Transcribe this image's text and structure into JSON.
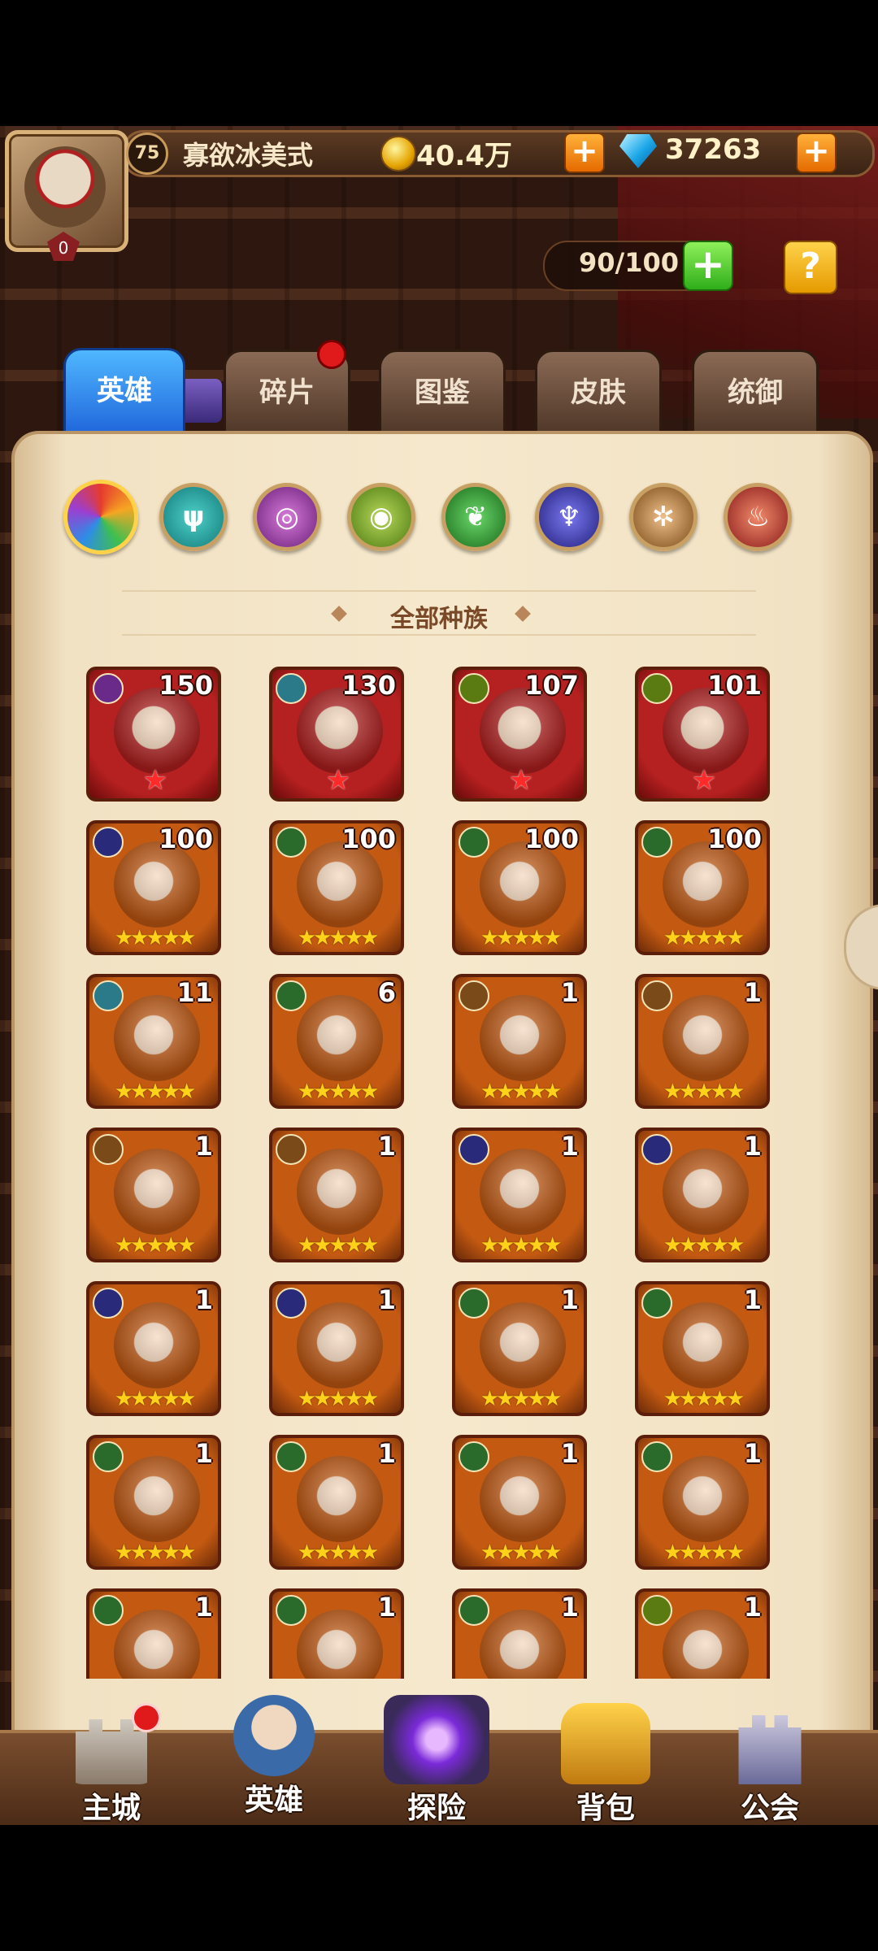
{
  "header": {
    "player_level": "75",
    "player_name": "寡欲冰美式",
    "vip_level": "0",
    "gold": "40.4万",
    "gems": "37263",
    "hero_capacity": "90/100"
  },
  "tabs": [
    {
      "label": "英雄",
      "active": true
    },
    {
      "label": "碎片"
    },
    {
      "label": "图鉴"
    },
    {
      "label": "皮肤"
    },
    {
      "label": "统御"
    }
  ],
  "race_filter": {
    "title": "全部种族",
    "icons": [
      "all-races-icon",
      "race-1-icon",
      "race-2-icon",
      "race-3-icon",
      "race-4-icon",
      "race-5-icon",
      "race-6-icon",
      "race-7-icon"
    ]
  },
  "heroes": [
    {
      "level": "150",
      "stars": "★",
      "star_type": "red",
      "frame": "red"
    },
    {
      "level": "130",
      "stars": "★",
      "star_type": "red",
      "frame": "red"
    },
    {
      "level": "107",
      "stars": "★",
      "star_type": "red",
      "frame": "red"
    },
    {
      "level": "101",
      "stars": "★",
      "star_type": "red",
      "frame": "red"
    },
    {
      "level": "100",
      "stars": "★★★★★",
      "frame": "orange"
    },
    {
      "level": "100",
      "stars": "★★★★★",
      "frame": "orange"
    },
    {
      "level": "100",
      "stars": "★★★★★",
      "frame": "orange"
    },
    {
      "level": "100",
      "stars": "★★★★★",
      "frame": "orange"
    },
    {
      "level": "11",
      "stars": "★★★★★",
      "frame": "orange"
    },
    {
      "level": "6",
      "stars": "★★★★★",
      "frame": "orange"
    },
    {
      "level": "1",
      "stars": "★★★★★",
      "frame": "orange"
    },
    {
      "level": "1",
      "stars": "★★★★★",
      "frame": "orange"
    },
    {
      "level": "1",
      "stars": "★★★★★",
      "frame": "orange"
    },
    {
      "level": "1",
      "stars": "★★★★★",
      "frame": "orange"
    },
    {
      "level": "1",
      "stars": "★★★★★",
      "frame": "orange"
    },
    {
      "level": "1",
      "stars": "★★★★★",
      "frame": "orange"
    },
    {
      "level": "1",
      "stars": "★★★★★",
      "frame": "orange"
    },
    {
      "level": "1",
      "stars": "★★★★★",
      "frame": "orange"
    },
    {
      "level": "1",
      "stars": "★★★★★",
      "frame": "orange"
    },
    {
      "level": "1",
      "stars": "★★★★★",
      "frame": "orange"
    },
    {
      "level": "1",
      "stars": "★★★★★",
      "frame": "orange"
    },
    {
      "level": "1",
      "stars": "★★★★★",
      "frame": "orange"
    },
    {
      "level": "1",
      "stars": "★★★★★",
      "frame": "orange"
    },
    {
      "level": "1",
      "stars": "★★★★★",
      "frame": "orange"
    },
    {
      "level": "1",
      "stars": "★★★★★",
      "frame": "orange"
    },
    {
      "level": "1",
      "stars": "★★★★★",
      "frame": "orange"
    },
    {
      "level": "1",
      "stars": "★★★★★",
      "frame": "orange"
    },
    {
      "level": "1",
      "stars": "★★★★★",
      "frame": "orange"
    }
  ],
  "bottom_nav": [
    {
      "label": "主城"
    },
    {
      "label": "英雄"
    },
    {
      "label": "探险"
    },
    {
      "label": "背包"
    },
    {
      "label": "公会"
    }
  ],
  "colors": {
    "active_tab": "#1c5fd8",
    "red_frame": "#b52020",
    "orange_frame": "#c45a12",
    "notification_dot": "#e01a1a"
  }
}
